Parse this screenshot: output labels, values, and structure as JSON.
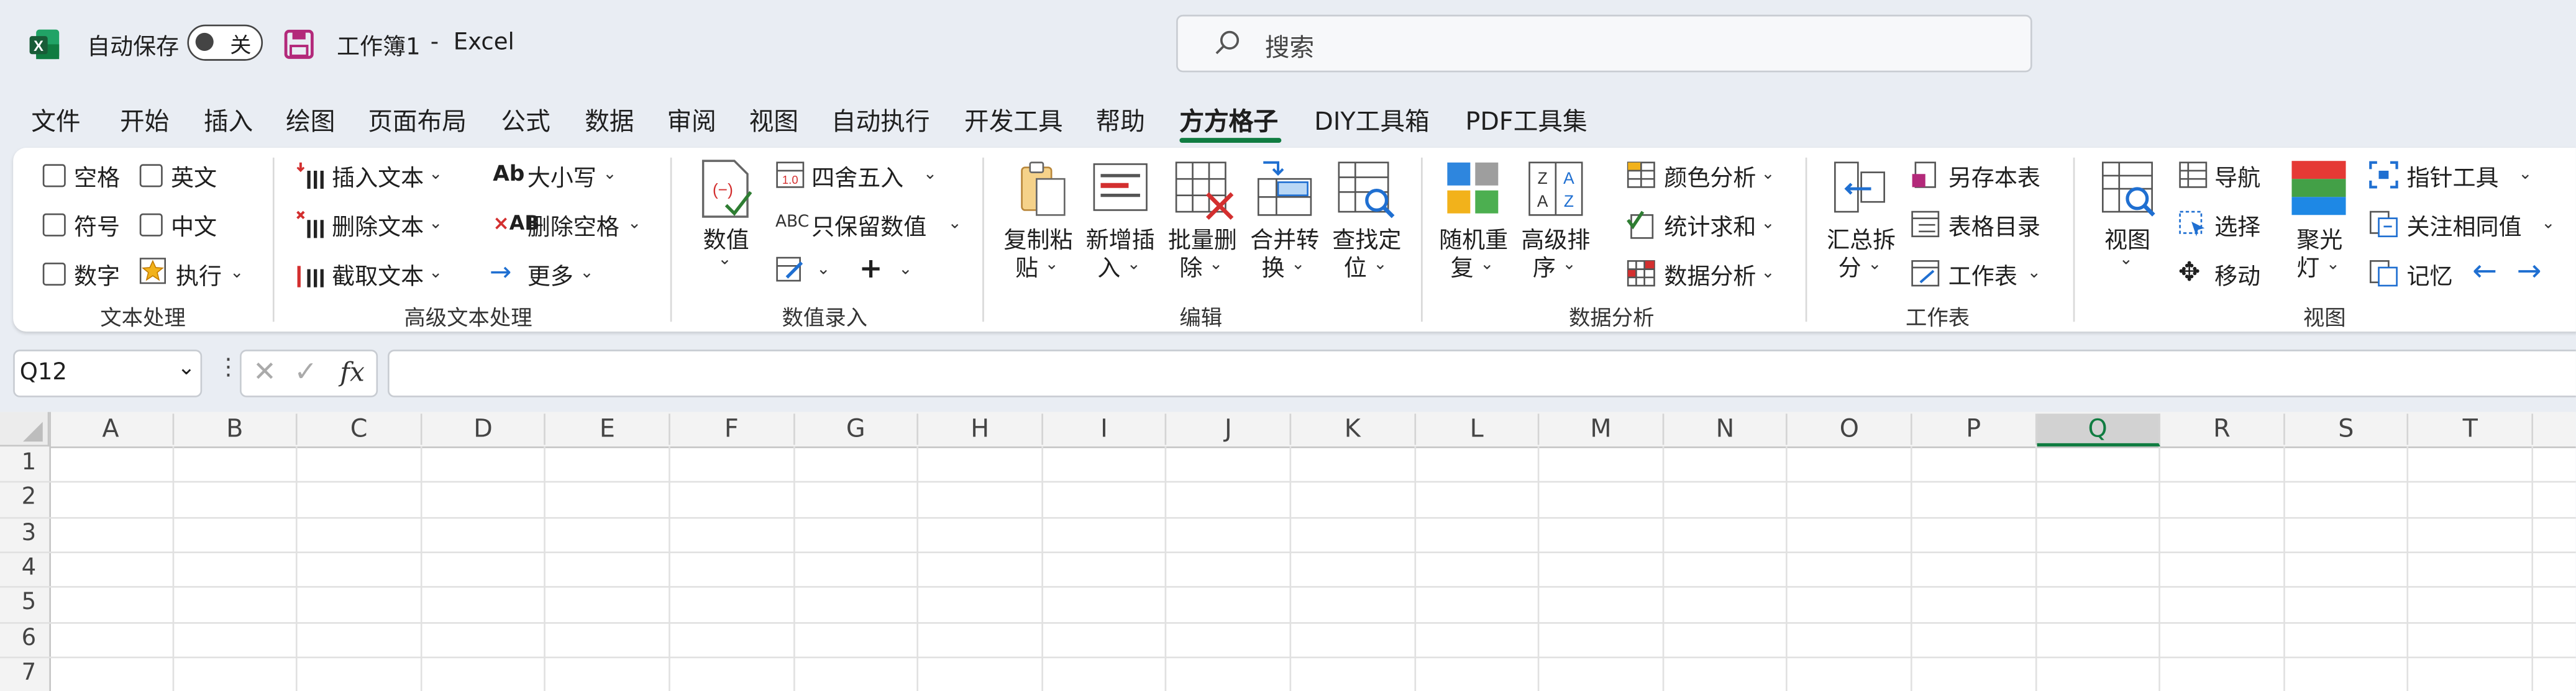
{
  "titlebar": {
    "autosave_label": "自动保存",
    "autosave_state": "关",
    "doc_title": "工作簿1",
    "sep": "-",
    "app_name": "Excel",
    "search_placeholder": "搜索"
  },
  "tabs": [
    "文件",
    "开始",
    "插入",
    "绘图",
    "页面布局",
    "公式",
    "数据",
    "审阅",
    "视图",
    "自动执行",
    "开发工具",
    "帮助",
    "方方格子",
    "DIY工具箱",
    "PDF工具集"
  ],
  "active_tab": "方方格子",
  "ribbon": {
    "text_processing": {
      "label": "文本处理",
      "items": [
        "空格",
        "英文",
        "符号",
        "中文",
        "数字",
        "执行"
      ]
    },
    "advanced_text": {
      "label": "高级文本处理",
      "items": [
        "插入文本",
        "删除文本",
        "截取文本",
        "大小写",
        "删除空格",
        "更多"
      ]
    },
    "value_entry": {
      "label": "数值录入",
      "items": [
        "数值",
        "四舍五入",
        "只保留数值"
      ]
    },
    "edit": {
      "label": "编辑",
      "items": [
        [
          "复制粘",
          "贴"
        ],
        [
          "新增插",
          "入"
        ],
        [
          "批量删",
          "除"
        ],
        [
          "合并转",
          "换"
        ],
        [
          "查找定",
          "位"
        ]
      ]
    },
    "data_analysis": {
      "label": "数据分析",
      "items": [
        [
          "随机重",
          "复"
        ],
        [
          "高级排",
          "序"
        ],
        "颜色分析",
        "统计求和",
        "数据分析"
      ]
    },
    "worksheet": {
      "label": "工作表",
      "items": [
        [
          "汇总拆",
          "分"
        ],
        "另存本表",
        "表格目录",
        "工作表"
      ]
    },
    "view": {
      "label": "视图",
      "items": [
        "视图",
        [
          "聚光",
          "灯"
        ],
        "导航",
        "选择",
        "移动",
        "指针工具",
        "关注相同值",
        "记忆"
      ]
    }
  },
  "formula_bar": {
    "name_box": "Q12",
    "fx": "fx"
  },
  "columns": [
    "A",
    "B",
    "C",
    "D",
    "E",
    "F",
    "G",
    "H",
    "I",
    "J",
    "K",
    "L",
    "M",
    "N",
    "O",
    "P",
    "Q",
    "R",
    "S",
    "T"
  ],
  "rows": [
    "1",
    "2",
    "3",
    "4",
    "5",
    "6",
    "7"
  ],
  "selected_cell": "Q12",
  "colors": {
    "excel_green": "#107c41",
    "active_col": "#107c41",
    "ribbon_bg": "#ffffff",
    "app_bg": "#e9edf3"
  }
}
